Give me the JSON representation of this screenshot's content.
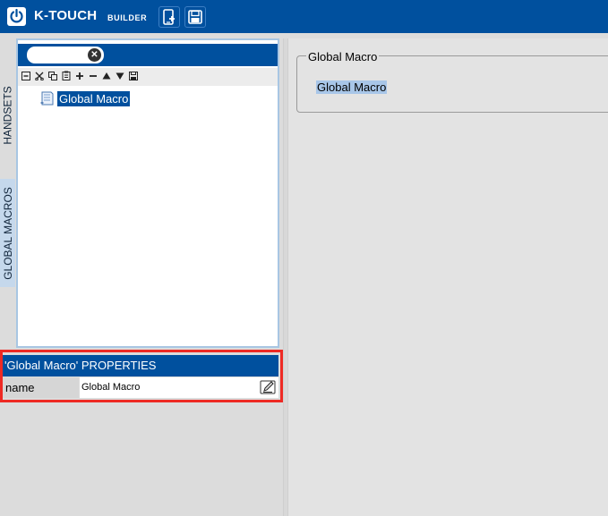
{
  "app": {
    "brand": "K-TOUCH",
    "subtitle": "BUILDER",
    "toolbar_icons": [
      "new-device-icon",
      "save-icon"
    ]
  },
  "side_tabs": {
    "handsets": "HANDSETS",
    "global_macros": "GLOBAL MACROS"
  },
  "tree": {
    "search": {
      "placeholder": "",
      "value": ""
    },
    "toolbar_icons": [
      "collapse-icon",
      "cut-icon",
      "copy-icon",
      "paste-icon",
      "add-icon",
      "remove-icon",
      "move-up-icon",
      "move-down-icon",
      "save-icon"
    ],
    "toolbar_glyphs": [
      "⊟",
      "✂",
      "⧉",
      "📋",
      "+",
      "−",
      "▲",
      "▼",
      "💾"
    ],
    "items": [
      {
        "label": "Global Macro",
        "selected": true,
        "icon": "document-icon"
      }
    ]
  },
  "properties": {
    "title": "'Global Macro' PROPERTIES",
    "rows": [
      {
        "name": "name",
        "value": "Global Macro",
        "icon": "edit-icon"
      }
    ]
  },
  "detail": {
    "legend": "Global Macro",
    "macro_name": "Global Macro"
  },
  "colors": {
    "brand_blue": "#00509e",
    "highlight_red": "#ee2a24",
    "selection_blue": "#a8c6e8",
    "panel_border": "#a8c6e3"
  }
}
